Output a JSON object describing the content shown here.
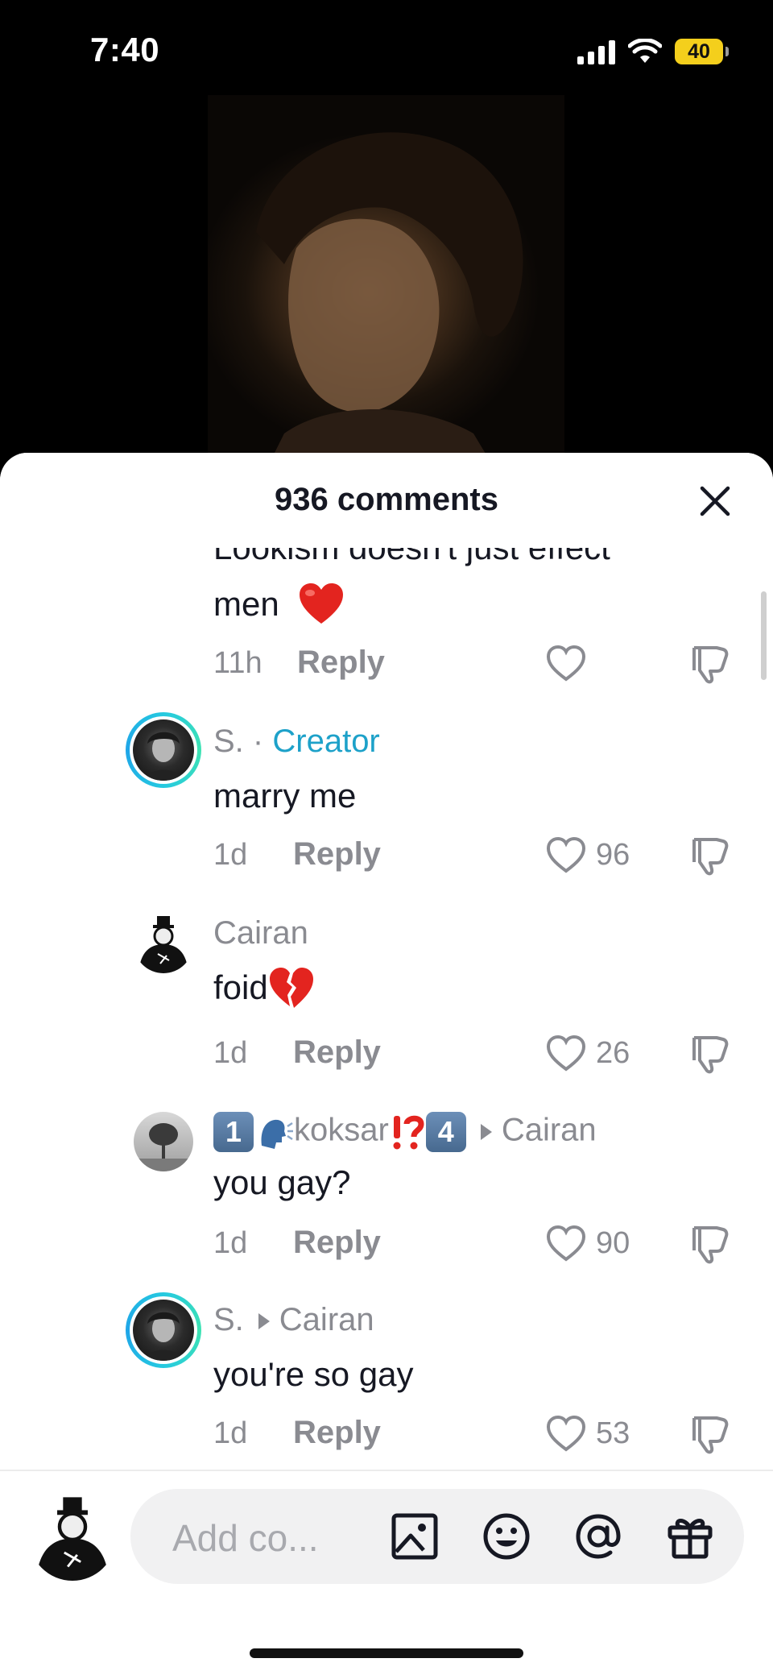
{
  "status_bar": {
    "time": "7:40",
    "battery": "40",
    "icons": [
      "cellular-signal-icon",
      "wifi-icon",
      "battery-icon"
    ]
  },
  "video": {
    "description_icon": "video-thumbnail"
  },
  "sheet": {
    "comment_count": "936 comments",
    "close_icon": "close-icon"
  },
  "comments": [
    {
      "text_line1": "Lookism doesn't just effect",
      "text_line2": "men",
      "emoji": "heart-emoji",
      "time": "11h",
      "reply": "Reply",
      "likes": ""
    },
    {
      "username": "S.",
      "separator": "·",
      "badge": "Creator",
      "text": "marry me",
      "time": "1d",
      "reply": "Reply",
      "likes": "96"
    },
    {
      "username": "Cairan",
      "text": "foid",
      "emoji": "broken-heart-emoji",
      "time": "1d",
      "reply": "Reply",
      "likes": "26"
    },
    {
      "username_prefix": "1",
      "username_mid": "koksar",
      "username_suffix": "4",
      "reply_to": "Cairan",
      "text": "you gay?",
      "time": "1d",
      "reply": "Reply",
      "likes": "90"
    },
    {
      "username": "S.",
      "reply_to": "Cairan",
      "text": "you're so gay",
      "time": "1d",
      "reply": "Reply",
      "likes": "53"
    }
  ],
  "input_bar": {
    "placeholder": "Add co...",
    "icons": [
      "image-icon",
      "emoji-icon",
      "mention-icon",
      "gift-icon"
    ]
  },
  "colors": {
    "creator_accent": "#1da1c9",
    "muted_text": "#8a8b91",
    "primary_text": "#161823",
    "ring": "#25c9e0"
  }
}
